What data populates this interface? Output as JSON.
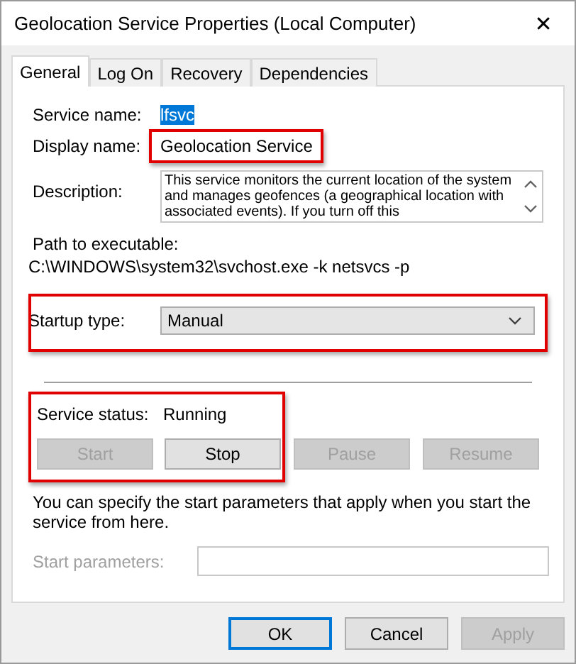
{
  "window": {
    "title": "Geolocation Service Properties (Local Computer)",
    "close": "✕"
  },
  "tabs": [
    {
      "label": "General",
      "selected": true
    },
    {
      "label": "Log On",
      "selected": false
    },
    {
      "label": "Recovery",
      "selected": false
    },
    {
      "label": "Dependencies",
      "selected": false
    }
  ],
  "service_name": {
    "label": "Service name:",
    "value": "lfsvc",
    "selected": true
  },
  "display_name": {
    "label": "Display name:",
    "value": "Geolocation Service",
    "highlighted": true
  },
  "description": {
    "label": "Description:",
    "value": "This service monitors the current location of the system and manages geofences (a geographical location with associated events).  If you turn off this"
  },
  "path": {
    "label": "Path to executable:",
    "value": "C:\\WINDOWS\\system32\\svchost.exe -k netsvcs -p"
  },
  "startup_type": {
    "label": "Startup type:",
    "value": "Manual",
    "highlighted": true
  },
  "service_status": {
    "label_text": "Service status:",
    "value": "Running",
    "highlighted": true,
    "buttons": [
      {
        "label": "Start",
        "disabled": true
      },
      {
        "label": "Stop",
        "disabled": false
      },
      {
        "label": "Pause",
        "disabled": true
      },
      {
        "label": "Resume",
        "disabled": true
      }
    ]
  },
  "hint": "You can specify the start parameters that apply when you start the service from here.",
  "start_parameters": {
    "label": "Start parameters:",
    "disabled": true
  },
  "footer_buttons": [
    {
      "label": "OK",
      "default": true,
      "disabled": false
    },
    {
      "label": "Cancel",
      "default": false,
      "disabled": false
    },
    {
      "label": "Apply",
      "default": false,
      "disabled": true
    }
  ]
}
